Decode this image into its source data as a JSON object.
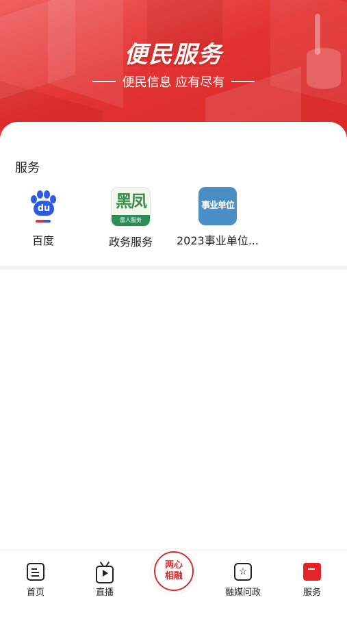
{
  "hero": {
    "title": "便民服务",
    "subtitle": "便民信息 应有尽有"
  },
  "section": {
    "title": "服务"
  },
  "services": [
    {
      "label": "百度",
      "icon": "baidu-paw-icon",
      "icon_text": "du"
    },
    {
      "label": "政务服务",
      "icon": "gov-service-icon",
      "icon_text": "雷人服务"
    },
    {
      "label": "2023事业单位...",
      "icon": "public-institution-icon",
      "icon_text": "事业单位"
    }
  ],
  "tabbar": {
    "items": [
      {
        "label": "首页",
        "icon": "document-icon"
      },
      {
        "label": "直播",
        "icon": "tv-play-icon"
      },
      {
        "label": "融媒问政",
        "icon": "star-box-icon"
      },
      {
        "label": "服务",
        "icon": "bookmark-icon",
        "active": true
      }
    ],
    "center": {
      "line1": "两心",
      "line2": "相融"
    }
  },
  "colors": {
    "brand_red": "#e23232",
    "active_red": "#e2232a",
    "baidu_blue": "#2d5be3",
    "gov_green": "#2e8b57",
    "inst_blue": "#4a8ec6"
  }
}
